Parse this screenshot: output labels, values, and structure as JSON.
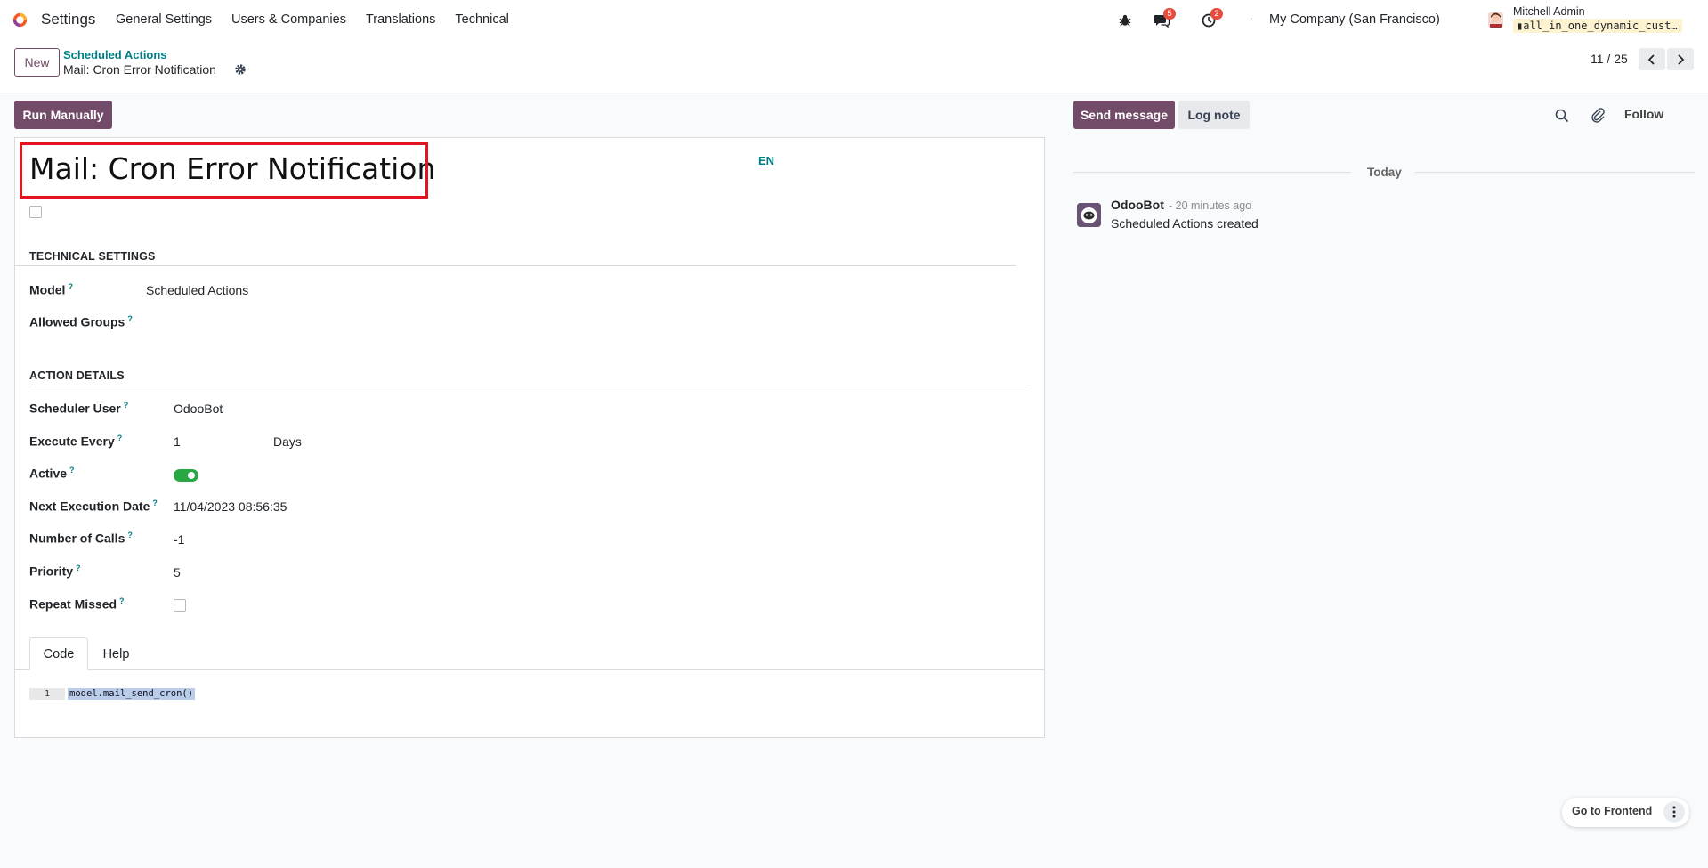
{
  "navbar": {
    "app_name": "Settings",
    "menu": [
      "General Settings",
      "Users & Companies",
      "Translations",
      "Technical"
    ],
    "messages_count": "5",
    "activities_count": "2",
    "company": "My Company (San Francisco)",
    "user_name": "Mitchell Admin",
    "db_name": "all_in_one_dynamic_cust…"
  },
  "control_panel": {
    "new_label": "New",
    "breadcrumb_parent": "Scheduled Actions",
    "breadcrumb_current": "Mail: Cron Error Notification",
    "pager": "11 / 25"
  },
  "form": {
    "run_label": "Run Manually",
    "title": "Mail: Cron Error Notification",
    "lang": "EN",
    "technical_section": "TECHNICAL SETTINGS",
    "model_label": "Model",
    "model_value": "Scheduled Actions",
    "groups_label": "Allowed Groups",
    "action_section": "ACTION DETAILS",
    "scheduler_user_label": "Scheduler User",
    "scheduler_user_value": "OdooBot",
    "execute_every_label": "Execute Every",
    "execute_every_value": "1",
    "execute_every_unit": "Days",
    "active_label": "Active",
    "active_value": true,
    "next_exec_label": "Next Execution Date",
    "next_exec_value": "11/04/2023 08:56:35",
    "num_calls_label": "Number of Calls",
    "num_calls_value": "-1",
    "priority_label": "Priority",
    "priority_value": "5",
    "repeat_missed_label": "Repeat Missed",
    "help_mark": "?",
    "tabs": [
      "Code",
      "Help"
    ],
    "code_line_number": "1",
    "code": "model.mail_send_cron()"
  },
  "chatter": {
    "send_label": "Send message",
    "log_label": "Log note",
    "follow_label": "Follow",
    "today_label": "Today",
    "author": "OdooBot",
    "time": "- 20 minutes ago",
    "body": "Scheduled Actions created"
  },
  "frontend": {
    "label": "Go to Frontend"
  },
  "colors": {
    "primary": "#714b67",
    "teal": "#017e84",
    "highlight_box": "#e3141e",
    "toggle_on": "#28a745"
  }
}
